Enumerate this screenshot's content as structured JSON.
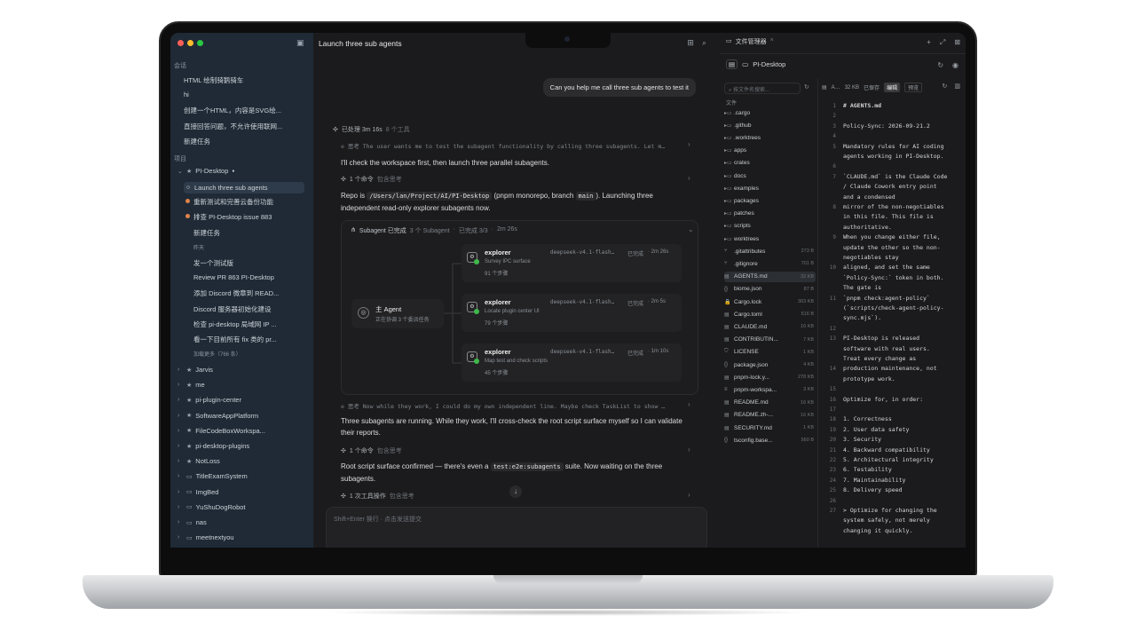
{
  "window": {
    "title": "Launch three sub agents"
  },
  "sidebar": {
    "conversations_label": "会话",
    "conversations": [
      "HTML 绘制骑鹅骑车",
      "hi",
      "创建一个HTML，内容是SVG绘...",
      "直接回答问题，不允许使用联网...",
      "新建任务"
    ],
    "projects_label": "项目",
    "current_project": {
      "name": "PI-Desktop",
      "dot": "●"
    },
    "project_items": [
      {
        "label": "Launch three sub agents",
        "ind": "○",
        "active": true
      },
      {
        "label": "重新测试和完善云备份功能",
        "dot": "#e0834a"
      },
      {
        "label": "排查 PI-Desktop issue 883",
        "dot": "#e0834a"
      },
      {
        "label": "新建任务"
      },
      {
        "label": "昨天",
        "small": true
      },
      {
        "label": "发一个测试版"
      },
      {
        "label": "Review PR 863 PI-Desktop"
      },
      {
        "label": "添加 Discord 微章到 READ..."
      },
      {
        "label": "Discord 服务器初始化建设"
      },
      {
        "label": "检查 pi-desktop 局域网 IP ..."
      },
      {
        "label": "看一下目前所有 fix 类的 pr..."
      },
      {
        "label": "加载更多（766 条）",
        "small": true
      }
    ],
    "other_projects": [
      {
        "name": "Jarvis",
        "icon": "★"
      },
      {
        "name": "me",
        "icon": "★"
      },
      {
        "name": "pi-plugin-center",
        "icon": "★"
      },
      {
        "name": "SoftwareAppPlatform",
        "icon": "★"
      },
      {
        "name": "FileCodeBoxWorkspa...",
        "icon": "★"
      },
      {
        "name": "pi-desktop-plugins",
        "icon": "★"
      },
      {
        "name": "NotLoss",
        "icon": "★"
      },
      {
        "name": "TitleExamSystem",
        "icon": "▭"
      },
      {
        "name": "ImgBed",
        "icon": "▭"
      },
      {
        "name": "YuShuDogRobot",
        "icon": "▭"
      },
      {
        "name": "nas",
        "icon": "▭"
      },
      {
        "name": "meetnextyou",
        "icon": "▭"
      }
    ]
  },
  "chat": {
    "user_message": "Can you help me call three sub agents to test it",
    "processed": {
      "label": "已处理 3m 16s",
      "sub": "8 个工具"
    },
    "think1": "思考 The user wants me to test the subagent functionality by calling three subagents. Let m…",
    "p1": "I'll check the workspace first, then launch three parallel subagents.",
    "cmd1": {
      "label": "1 个命令",
      "sub": "包含思考"
    },
    "p2_a": "Repo is ",
    "p2_code1": "/Users/lan/Project/AI/PI-Desktop",
    "p2_b": " (pnpm monorepo, branch ",
    "p2_code2": "main",
    "p2_c": "). Launching three independent read-only explorer subagents now.",
    "panel": {
      "title": "Subagent 已完成",
      "count": "3 个 Subagent",
      "done": "已完成 3/3",
      "time": "2m 26s"
    },
    "main_agent": {
      "title": "主 Agent",
      "sub": "正在协调 3 个委派任务"
    },
    "agents": [
      {
        "name": "explorer",
        "task": "Survey IPC surface",
        "steps": "91 个步骤",
        "model": "deepseek-v4.1-flash…",
        "status": "已完成",
        "time": "2m 26s"
      },
      {
        "name": "explorer",
        "task": "Locate plugin center UI",
        "steps": "79 个步骤",
        "model": "deepseek-v4.1-flash…",
        "status": "已完成",
        "time": "2m 5s"
      },
      {
        "name": "explorer",
        "task": "Map test and check scripts",
        "steps": "45 个步骤",
        "model": "deepseek-v4.1-flash…",
        "status": "已完成",
        "time": "1m 10s"
      }
    ],
    "think2": "思考 Now while they work, I could do my own independent line. Maybe check TaskList to show …",
    "p3": "Three subagents are running. While they work, I'll cross-check the root script surface myself so I can validate their reports.",
    "cmd2": {
      "label": "1 个命令",
      "sub": "包含思考"
    },
    "p4_a": "Root script surface confirmed — there's even a ",
    "p4_code": "test:e2e:subagents",
    "p4_b": " suite. Now waiting on the three subagents.",
    "tool1": {
      "label": "1 次工具操作",
      "sub": "包含思考"
    },
    "composer_placeholder": "Shift+Enter 换行 · 点击发送提交"
  },
  "filemanager": {
    "tab": "文件管理器",
    "root": "PI-Desktop",
    "search_placeholder": "按文件名搜索...",
    "files_label": "文件",
    "entries": [
      {
        "name": ".cargo",
        "icon": "▸▭"
      },
      {
        "name": ".github",
        "icon": "▸▭"
      },
      {
        "name": ".worktrees",
        "icon": "▸▭"
      },
      {
        "name": "apps",
        "icon": "▸▭"
      },
      {
        "name": "crates",
        "icon": "▸▭"
      },
      {
        "name": "docs",
        "icon": "▸▭"
      },
      {
        "name": "examples",
        "icon": "▸▭"
      },
      {
        "name": "packages",
        "icon": "▸▭"
      },
      {
        "name": "patches",
        "icon": "▸▭"
      },
      {
        "name": "scripts",
        "icon": "▸▭"
      },
      {
        "name": "worktrees",
        "icon": "▸▭"
      },
      {
        "name": ".gitattributes",
        "icon": "⑂",
        "size": "273 B"
      },
      {
        "name": ".gitignore",
        "icon": "⑂",
        "size": "701 B"
      },
      {
        "name": "AGENTS.md",
        "icon": "▤",
        "size": "32 KB",
        "selected": true
      },
      {
        "name": "biome.json",
        "icon": "{}",
        "size": "87 B"
      },
      {
        "name": "Cargo.lock",
        "icon": "🔒",
        "size": "303 KB"
      },
      {
        "name": "Cargo.toml",
        "icon": "▤",
        "size": "516 B"
      },
      {
        "name": "CLAUDE.md",
        "icon": "▤",
        "size": "16 KB"
      },
      {
        "name": "CONTRIBUTIN...",
        "icon": "▤",
        "size": "7 KB"
      },
      {
        "name": "LICENSE",
        "icon": "⛉",
        "size": "1 KB"
      },
      {
        "name": "package.json",
        "icon": "{}",
        "size": "4 KB"
      },
      {
        "name": "pnpm-lock.y...",
        "icon": "▤",
        "size": "278 KB"
      },
      {
        "name": "pnpm-workspa...",
        "icon": "≡",
        "size": "3 KB"
      },
      {
        "name": "README.md",
        "icon": "▤",
        "size": "16 KB"
      },
      {
        "name": "README.zh-...",
        "icon": "▤",
        "size": "16 KB"
      },
      {
        "name": "SECURITY.md",
        "icon": "▤",
        "size": "1 KB"
      },
      {
        "name": "tsconfig.base...",
        "icon": "{}",
        "size": "560 B"
      }
    ],
    "editor": {
      "file": "A…",
      "size": "32 KB",
      "state": "已保存",
      "edit_btn": "编辑",
      "preview_btn": "预览",
      "lines": [
        {
          "n": "1",
          "t": "# AGENTS.md",
          "bold": true
        },
        {
          "n": "2",
          "t": ""
        },
        {
          "n": "3",
          "t": "Policy-Sync: 2026-09-21.2"
        },
        {
          "n": "4",
          "t": ""
        },
        {
          "n": "5",
          "t": "Mandatory rules for AI coding"
        },
        {
          "n": "",
          "t": "agents working in PI-Desktop."
        },
        {
          "n": "6",
          "t": ""
        },
        {
          "n": "7",
          "t": " `CLAUDE.md` is the Claude Code"
        },
        {
          "n": "",
          "t": "/ Claude Cowork entry point"
        },
        {
          "n": "",
          "t": "and a condensed"
        },
        {
          "n": "8",
          "t": "mirror of the non-negotiables"
        },
        {
          "n": "",
          "t": "in this file. This file is"
        },
        {
          "n": "",
          "t": "authoritative."
        },
        {
          "n": "9",
          "t": "When you change either file,"
        },
        {
          "n": "",
          "t": "update the other so the non-"
        },
        {
          "n": "",
          "t": "negotiables stay"
        },
        {
          "n": "10",
          "t": "aligned, and set the same"
        },
        {
          "n": "",
          "t": "`Policy-Sync:` token in both."
        },
        {
          "n": "",
          "t": "The gate is"
        },
        {
          "n": "11",
          "t": "`pnpm check:agent-policy`"
        },
        {
          "n": "",
          "t": "(`scripts/check-agent-policy-"
        },
        {
          "n": "",
          "t": "sync.mjs`)."
        },
        {
          "n": "12",
          "t": ""
        },
        {
          "n": "13",
          "t": "PI-Desktop is released"
        },
        {
          "n": "",
          "t": "software with real users."
        },
        {
          "n": "",
          "t": "Treat every change as"
        },
        {
          "n": "14",
          "t": "production maintenance, not"
        },
        {
          "n": "",
          "t": "prototype work."
        },
        {
          "n": "15",
          "t": ""
        },
        {
          "n": "16",
          "t": "Optimize for, in order:"
        },
        {
          "n": "17",
          "t": ""
        },
        {
          "n": "18",
          "t": "1. Correctness"
        },
        {
          "n": "19",
          "t": "2. User data safety"
        },
        {
          "n": "20",
          "t": "3. Security"
        },
        {
          "n": "21",
          "t": "4. Backward compatibility"
        },
        {
          "n": "22",
          "t": "5. Architectural integrity"
        },
        {
          "n": "23",
          "t": "6. Testability"
        },
        {
          "n": "24",
          "t": "7. Maintainability"
        },
        {
          "n": "25",
          "t": "8. Delivery speed"
        },
        {
          "n": "26",
          "t": ""
        },
        {
          "n": "27",
          "t": "> Optimize for changing the"
        },
        {
          "n": "",
          "t": "system safely, not merely"
        },
        {
          "n": "",
          "t": "changing it quickly."
        },
        {
          "n": "",
          "t": ""
        },
        {
          "n": "28",
          "t": ""
        }
      ]
    }
  },
  "colors": {
    "red": "#fe5f57",
    "yellow": "#febc2e",
    "green": "#28c840",
    "success": "#3fb94a",
    "warn": "#e0834a"
  }
}
